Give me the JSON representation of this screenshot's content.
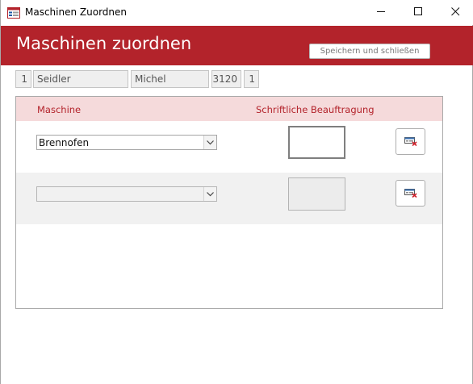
{
  "window": {
    "title": "Maschinen Zuordnen",
    "icons": {
      "app": "form-icon",
      "minimize": "minimize-icon",
      "maximize": "maximize-icon",
      "close": "close-icon"
    }
  },
  "header": {
    "title": "Maschinen zuordnen",
    "save_button": "Speichern und schließen",
    "color": "#b3232b"
  },
  "record": {
    "id": "1",
    "last_name": "Seidler",
    "first_name": "Michel",
    "number": "3120",
    "flag": "1"
  },
  "subform": {
    "columns": {
      "maschine": "Maschine",
      "beauftragung": "Schriftliche Beauftragung"
    },
    "rows": [
      {
        "maschine": "Brennofen",
        "delete_icon": "delete-record-icon"
      },
      {
        "maschine": "",
        "delete_icon": "delete-record-icon"
      }
    ]
  }
}
